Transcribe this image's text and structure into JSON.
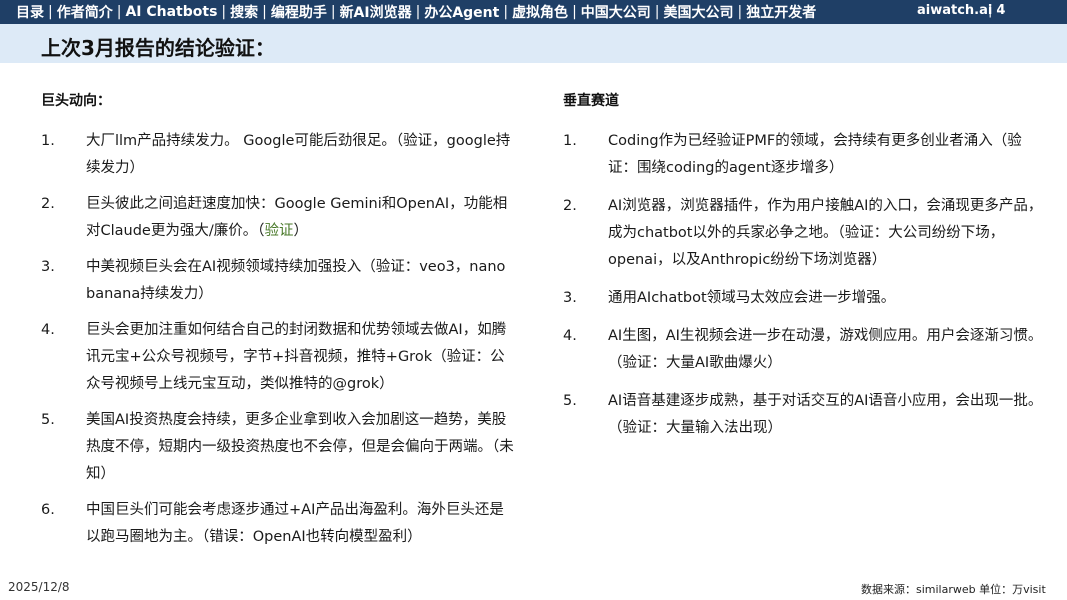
{
  "nav": {
    "items": [
      "目录",
      "作者简介",
      "AI Chatbots",
      "搜索",
      "编程助手",
      "新AI浏览器",
      "办公Agent",
      "虚拟角色",
      "中国大公司",
      "美国大公司",
      "独立开发者"
    ],
    "separator": "|"
  },
  "brand": "aiwatch.ai",
  "page_number": "4",
  "page_sep": "|",
  "title": "上次3月报告的结论验证：",
  "left": {
    "heading": "巨头动向：",
    "items": [
      {
        "n": "1.",
        "text": "大厂llm产品持续发力。 Google可能后劲很足。（验证，google持续发力）"
      },
      {
        "n": "2.",
        "text": "巨头彼此之间追赶速度加快：Google Gemini和OpenAI，功能相对Claude更为强大/廉价。（",
        "verify": "验证",
        "tail": "）"
      },
      {
        "n": "3.",
        "text": "中美视频巨头会在AI视频领域持续加强投入（验证：veo3，nano banana持续发力）"
      },
      {
        "n": "4.",
        "text": "巨头会更加注重如何结合自己的封闭数据和优势领域去做AI，如腾讯元宝+公众号视频号，字节+抖音视频，推特+Grok（验证：公众号视频号上线元宝互动，类似推特的@grok）"
      },
      {
        "n": "5.",
        "text": "美国AI投资热度会持续，更多企业拿到收入会加剧这一趋势，美股热度不停，短期内一级投资热度也不会停，但是会偏向于两端。（未知）"
      },
      {
        "n": "6.",
        "text": "中国巨头们可能会考虑逐步通过+AI产品出海盈利。海外巨头还是以跑马圈地为主。（错误：OpenAI也转向模型盈利）"
      }
    ]
  },
  "right": {
    "heading": "垂直赛道",
    "items": [
      {
        "n": "1.",
        "text": "Coding作为已经验证PMF的领域，会持续有更多创业者涌入（验证：围绕coding的agent逐步增多）"
      },
      {
        "n": "2.",
        "text": "AI浏览器，浏览器插件，作为用户接触AI的入口，会涌现更多产品，成为chatbot以外的兵家必争之地。（验证：大公司纷纷下场，openai，以及Anthropic纷纷下场浏览器）"
      },
      {
        "n": "3.",
        "text": "通用AIchatbot领域马太效应会进一步增强。"
      },
      {
        "n": "4.",
        "text": "AI生图，AI生视频会进一步在动漫，游戏侧应用。用户会逐渐习惯。（验证：大量AI歌曲爆火）"
      },
      {
        "n": "5.",
        "text": "AI语音基建逐步成熟，基于对话交互的AI语音小应用，会出现一批。（验证：大量输入法出现）"
      }
    ]
  },
  "footer": {
    "date": "2025/12/8",
    "source": "数据来源：similarweb  单位：万visit"
  },
  "colors": {
    "nav_bg": "#1f3f66",
    "title_band_bg": "#ddeaf7",
    "verify_green": "#4a7a2a"
  }
}
